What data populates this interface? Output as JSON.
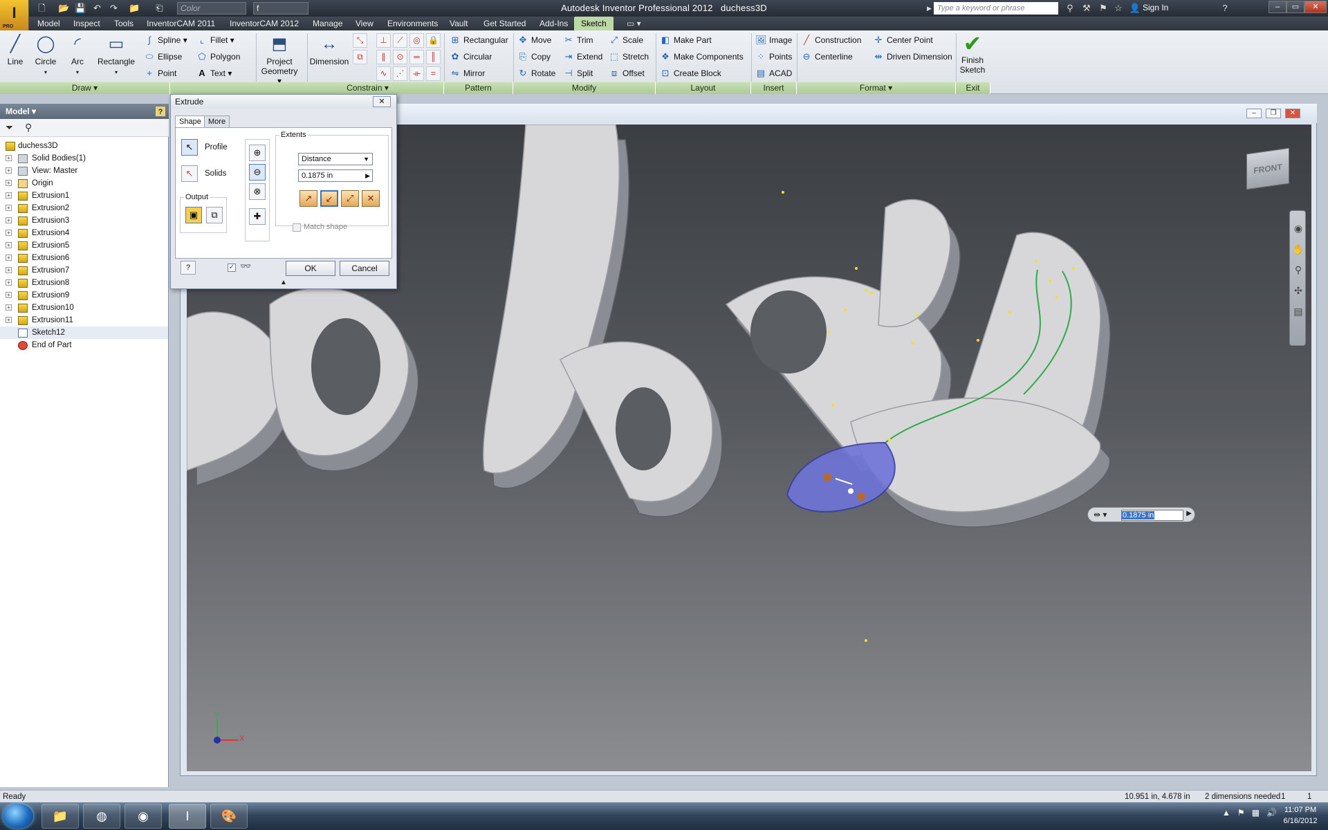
{
  "app": {
    "logo_text": "I",
    "logo_badge": "PRO",
    "window_title": "Autodesk Inventor Professional 2012",
    "document_name": "duchess3D",
    "color_placeholder": "Color",
    "fx_value": "f",
    "search_placeholder": "Type a keyword or phrase",
    "sign_in": "Sign In"
  },
  "menu_tabs": [
    "Model",
    "Inspect",
    "Tools",
    "InventorCAM 2011",
    "InventorCAM 2012",
    "Manage",
    "View",
    "Environments",
    "Vault",
    "Get Started",
    "Add-Ins",
    "Sketch"
  ],
  "ribbon": {
    "draw": {
      "label": "Draw",
      "line": "Line",
      "circle": "Circle",
      "arc": "Arc",
      "rectangle": "Rectangle",
      "spline": "Spline",
      "ellipse": "Ellipse",
      "point": "Point",
      "fillet": "Fillet",
      "polygon": "Polygon",
      "text": "Text"
    },
    "project_geometry": [
      "Project",
      "Geometry"
    ],
    "constrain": {
      "label": "Constrain",
      "dimension": "Dimension"
    },
    "pattern": {
      "label": "Pattern",
      "rectangular": "Rectangular",
      "circular": "Circular",
      "mirror": "Mirror"
    },
    "modify": {
      "label": "Modify",
      "move": "Move",
      "copy": "Copy",
      "rotate": "Rotate",
      "trim": "Trim",
      "extend": "Extend",
      "split": "Split",
      "scale": "Scale",
      "stretch": "Stretch",
      "offset": "Offset"
    },
    "layout": {
      "label": "Layout",
      "make_part": "Make Part",
      "make_components": "Make Components",
      "create_block": "Create Block"
    },
    "insert": {
      "label": "Insert",
      "image": "Image",
      "points": "Points",
      "acad": "ACAD"
    },
    "format": {
      "label": "Format",
      "construction": "Construction",
      "centerline": "Centerline",
      "center_point": "Center Point",
      "driven_dimension": "Driven Dimension"
    },
    "exit": {
      "label": "Exit",
      "finish_line1": "Finish",
      "finish_line2": "Sketch"
    }
  },
  "browser": {
    "title": "Model",
    "root": "duchess3D",
    "items": [
      "Solid Bodies(1)",
      "View: Master",
      "Origin",
      "Extrusion1",
      "Extrusion2",
      "Extrusion3",
      "Extrusion4",
      "Extrusion5",
      "Extrusion6",
      "Extrusion7",
      "Extrusion8",
      "Extrusion9",
      "Extrusion10",
      "Extrusion11",
      "Sketch12",
      "End of Part"
    ]
  },
  "dialog": {
    "title": "Extrude",
    "tab_shape": "Shape",
    "tab_more": "More",
    "profile": "Profile",
    "solids": "Solids",
    "output": "Output",
    "extents": "Extents",
    "extents_method": "Distance",
    "distance": "0.1875 in",
    "match_shape": "Match shape",
    "preview_checked": "✓",
    "ok": "OK",
    "cancel": "Cancel"
  },
  "viewport": {
    "viewcube_label": "FRONT",
    "dimension_value": "0.1875 in",
    "triad_x": "X",
    "triad_y": "Y",
    "colors": {
      "body": "#d7d7d9",
      "side": "#8e9197",
      "profile": "#6f74d8"
    }
  },
  "status": {
    "left": "Ready",
    "coords": "10.951 in, 4.678 in",
    "dimensions_needed": "2 dimensions needed",
    "count1": "1",
    "count2": "1"
  },
  "taskbar": {
    "time": "11:07 PM",
    "date": "6/16/2012"
  }
}
